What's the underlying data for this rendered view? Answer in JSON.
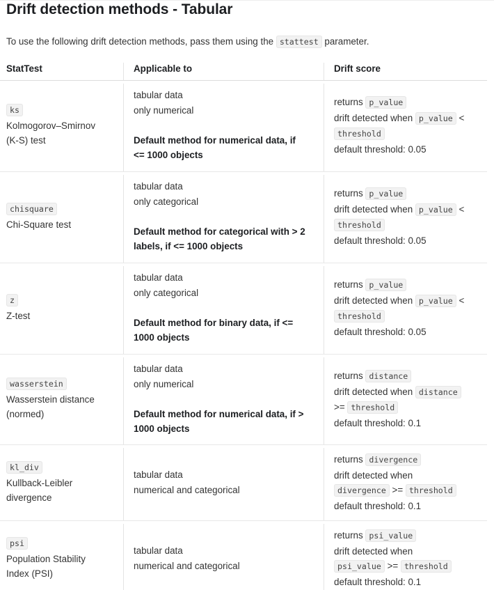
{
  "page": {
    "title": "Drift detection methods - Tabular",
    "intro_before": "To use the following drift detection methods, pass them using the",
    "intro_code": "stattest",
    "intro_after": "parameter."
  },
  "table": {
    "headers": [
      "StatTest",
      "Applicable to",
      "Drift score"
    ],
    "rows": [
      {
        "code": "ks",
        "name": [
          "Kolmogorov–Smirnov",
          "(K-S) test"
        ],
        "applicable": [
          "tabular data",
          "only numerical"
        ],
        "default_note": [
          "Default method for numerical data, if",
          "<= 1000 objects"
        ],
        "score": {
          "returns_label": "returns",
          "returns_code": "p_value",
          "line2_text": "drift detected when",
          "line2_code": "p_value",
          "line2_op": "<",
          "line3_code": "threshold",
          "default": "default threshold: 0.05"
        }
      },
      {
        "code": "chisquare",
        "name": [
          "Chi-Square test"
        ],
        "applicable": [
          "tabular data",
          "only categorical"
        ],
        "default_note": [
          "Default method for categorical with > 2",
          "labels, if <= 1000 objects"
        ],
        "score": {
          "returns_label": "returns",
          "returns_code": "p_value",
          "line2_text": "drift detected when",
          "line2_code": "p_value",
          "line2_op": "<",
          "line3_code": "threshold",
          "default": "default threshold: 0.05"
        }
      },
      {
        "code": "z",
        "name": [
          "Z-test"
        ],
        "applicable": [
          "tabular data",
          "only categorical"
        ],
        "default_note": [
          "Default method for binary data, if <=",
          "1000 objects"
        ],
        "score": {
          "returns_label": "returns",
          "returns_code": "p_value",
          "line2_text": "drift detected when",
          "line2_code": "p_value",
          "line2_op": "<",
          "line3_code": "threshold",
          "default": "default threshold: 0.05"
        }
      },
      {
        "code": "wasserstein",
        "name": [
          "Wasserstein distance",
          "(normed)"
        ],
        "applicable": [
          "tabular data",
          "only numerical"
        ],
        "default_note": [
          "Default method for numerical data, if >",
          "1000 objects"
        ],
        "score": {
          "returns_label": "returns",
          "returns_code": "distance",
          "line2_text": "drift detected when",
          "line2_code": "distance",
          "line3_op": ">=",
          "line3_code": "threshold",
          "default": "default threshold: 0.1"
        }
      },
      {
        "code": "kl_div",
        "name": [
          "Kullback-Leibler",
          "divergence"
        ],
        "applicable": [
          "tabular data",
          "numerical and categorical"
        ],
        "score": {
          "returns_label": "returns",
          "returns_code": "divergence",
          "line2_text": "drift detected when",
          "line3_code_a": "divergence",
          "line3_op": ">=",
          "line3_code": "threshold",
          "default": "default threshold: 0.1"
        }
      },
      {
        "code": "psi",
        "name": [
          "Population Stability",
          "Index (PSI)"
        ],
        "applicable": [
          "tabular data",
          "numerical and categorical"
        ],
        "score": {
          "returns_label": "returns",
          "returns_code": "psi_value",
          "line2_text": "drift detected when",
          "line3_code_a": "psi_value",
          "line3_op": ">=",
          "line3_code": "threshold",
          "default": "default threshold: 0.1"
        }
      }
    ]
  }
}
